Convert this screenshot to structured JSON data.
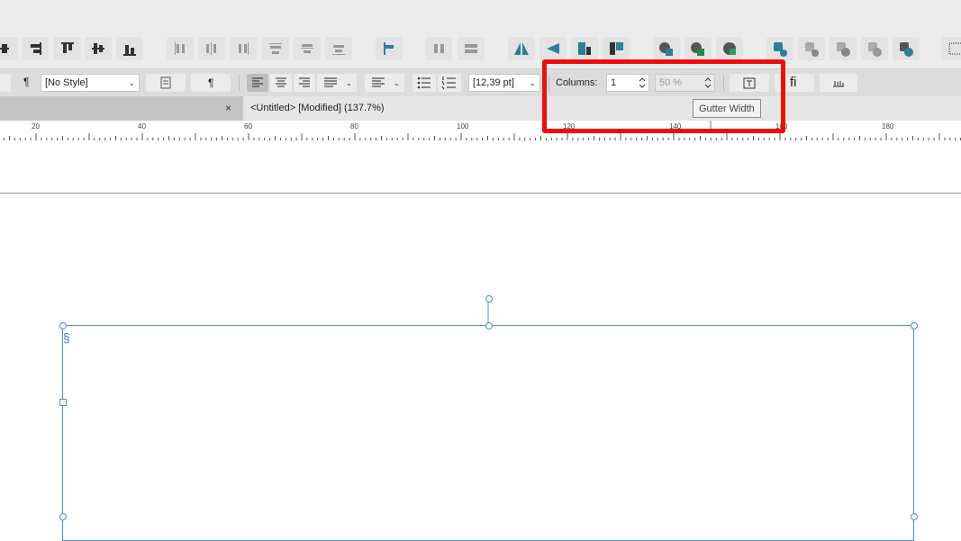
{
  "toolbar2": {
    "paragraph_mark": "¶",
    "style_select": "[No Style]",
    "show_marks_label": "¶",
    "font_size": "[12,39 pt]",
    "columns_label": "Columns:",
    "columns_value": "1",
    "gutter_percent": "50 %",
    "ligature_label": "fi"
  },
  "tab": {
    "close_label": "×",
    "title": "<Untitled> [Modified] (137.7%)"
  },
  "ruler": {
    "labels": [
      "20",
      "40",
      "60",
      "80",
      "100",
      "120",
      "140",
      "160",
      "180"
    ]
  },
  "tooltip": {
    "text": "Gutter Width"
  },
  "frame": {
    "section_mark": "§"
  },
  "colors": {
    "accent_teal": "#2a7f9a",
    "selection_blue": "#4a90c8",
    "highlight_red": "#f20c0c"
  }
}
